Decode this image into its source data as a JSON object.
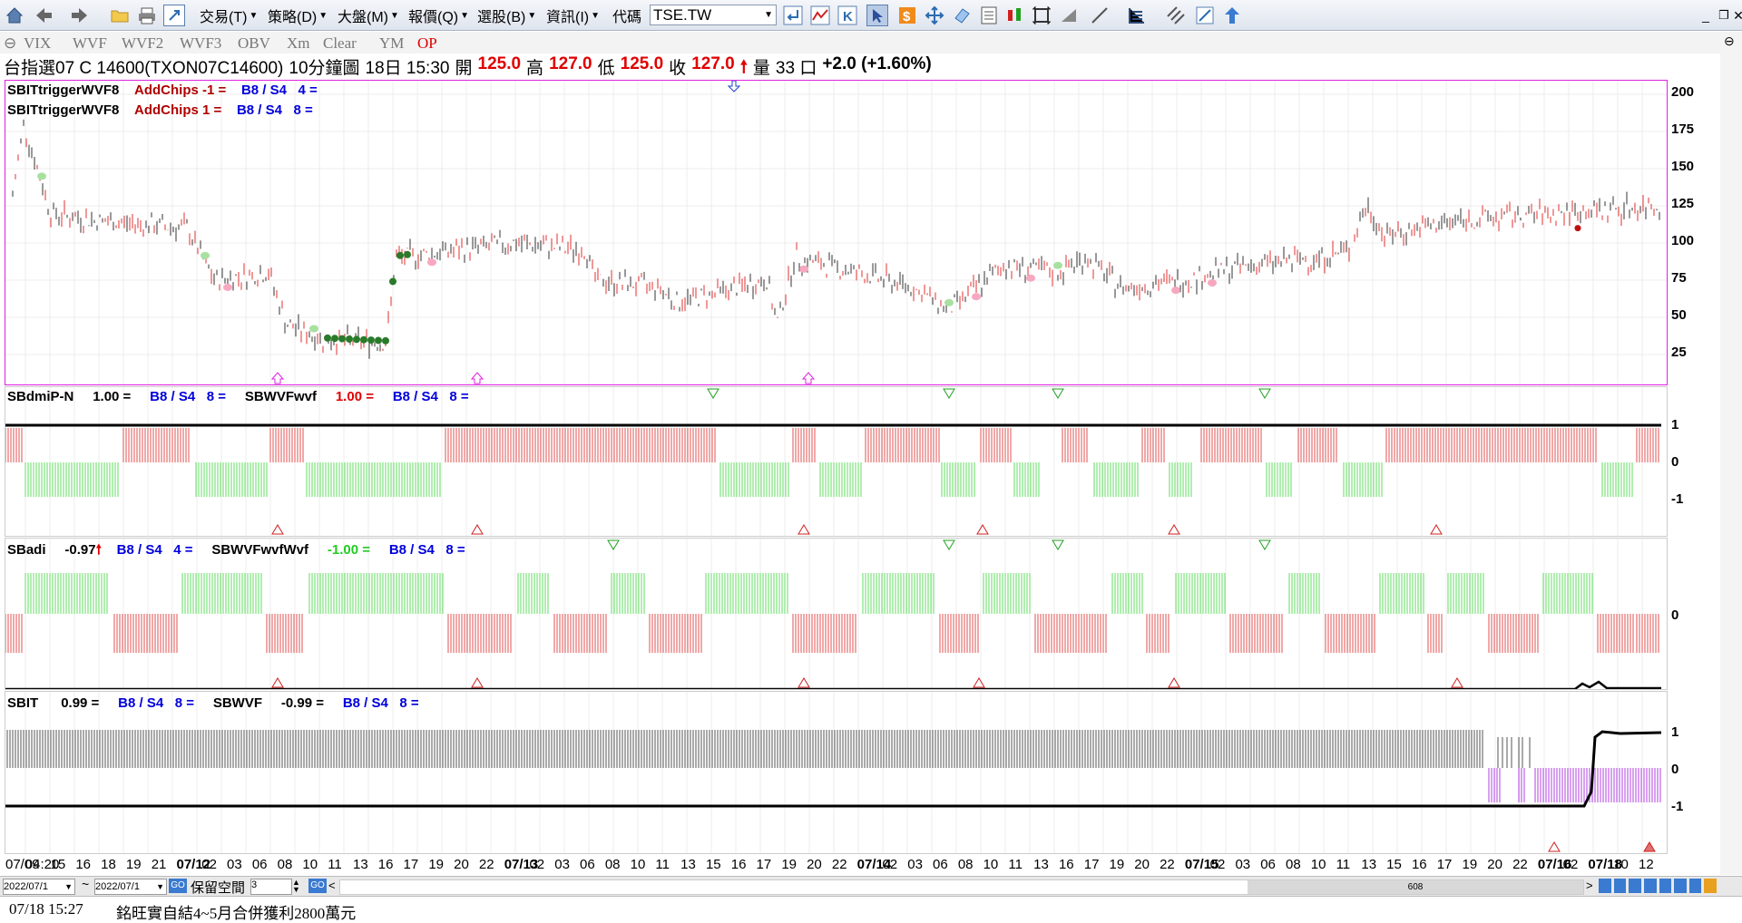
{
  "toolbar": {
    "menus": [
      "交易(T)",
      "策略(D)",
      "大盤(M)",
      "報價(Q)",
      "選股(B)",
      "資訊(I)"
    ],
    "code_label": "代碼",
    "code_value": "TSE.TW"
  },
  "tabs": [
    "VIX",
    "WVF",
    "WVF2",
    "WVF3",
    "OBV",
    "Xm",
    "Clear",
    "YM",
    "OP"
  ],
  "quote": {
    "name": "台指選07 C 14600(TXON07C14600)",
    "period": "10分鐘圖",
    "date": "18日 15:30",
    "open_label": "開",
    "open": "125.0",
    "high_label": "高",
    "high": "127.0",
    "low_label": "低",
    "low": "125.0",
    "close_label": "收",
    "close": "127.0",
    "volume_label": "量",
    "volume": "33 口",
    "change": "+2.0 (+1.60%)"
  },
  "pane1": {
    "line1": {
      "name": "SBITtriggerWVF8",
      "ind": "AddChips -1 =",
      "bs": "B8 / S4",
      "n": "4 ="
    },
    "line2": {
      "name": "SBITtriggerWVF8",
      "ind": "AddChips 1 =",
      "bs": "B8 / S4",
      "n": "8 ="
    },
    "yticks": [
      "200",
      "175",
      "150",
      "125",
      "100",
      "75",
      "50",
      "25"
    ]
  },
  "pane2": {
    "name1": "SBdmiP-N",
    "val1": "1.00 =",
    "bs1": "B8 / S4",
    "n1": "8 =",
    "name2": "SBWVFwvf",
    "val2": "1.00 =",
    "bs2": "B8 / S4",
    "n2": "8 =",
    "yticks": [
      "1",
      "0",
      "-1"
    ]
  },
  "pane3": {
    "name1": "SBadi",
    "val1": "-0.97",
    "bs1": "B8 / S4",
    "n1": "4 =",
    "name2": "SBWVFwvfWvf",
    "val2": "-1.00 =",
    "bs2": "B8 / S4",
    "n2": "8 =",
    "yticks": [
      "0"
    ]
  },
  "pane4": {
    "name1": "SBIT",
    "val1": "0.99 =",
    "bs1": "B8 / S4",
    "n1": "8 =",
    "name2": "SBWVF",
    "val2": "-0.99 =",
    "bs2": "B8 / S4",
    "n2": "8 =",
    "yticks": [
      "1",
      "0",
      "-1"
    ]
  },
  "xaxis": [
    "07/09",
    "04:20",
    "15",
    "16",
    "18",
    "19",
    "21",
    "07/12",
    "02",
    "03",
    "06",
    "08",
    "10",
    "11",
    "13",
    "16",
    "17",
    "19",
    "20",
    "22",
    "07/13",
    "02",
    "03",
    "06",
    "08",
    "10",
    "11",
    "13",
    "15",
    "16",
    "17",
    "19",
    "20",
    "22",
    "07/14",
    "02",
    "03",
    "06",
    "08",
    "10",
    "11",
    "13",
    "16",
    "17",
    "19",
    "20",
    "22",
    "07/15",
    "02",
    "03",
    "06",
    "08",
    "10",
    "11",
    "13",
    "15",
    "16",
    "17",
    "19",
    "20",
    "22",
    "07/16",
    "02",
    "07/18",
    "10",
    "12"
  ],
  "bottom": {
    "date_from": "2022/07/1",
    "date_to": "2022/07/1",
    "reserve_label": "保留空間",
    "reserve_value": "3",
    "scroll_value": "608"
  },
  "status": {
    "time": "07/18 15:27",
    "news": "銘旺實自結4~5月合併獲利2800萬元"
  }
}
